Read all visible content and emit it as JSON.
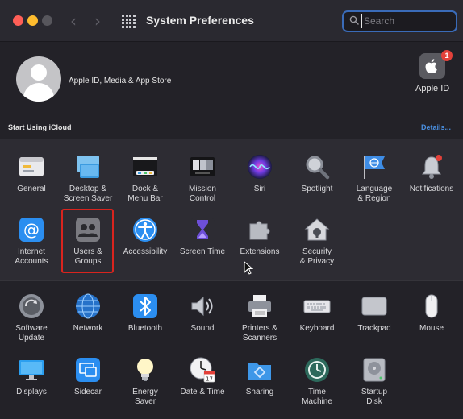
{
  "window": {
    "title": "System Preferences"
  },
  "search": {
    "placeholder": "Search"
  },
  "account": {
    "label": "Apple ID, Media & App Store",
    "apple_id_label": "Apple ID",
    "badge_count": "1",
    "icloud_label": "Start Using iCloud",
    "details_link": "Details..."
  },
  "prefs_row1": [
    {
      "label": "General",
      "icon": "general-icon"
    },
    {
      "label": "Desktop &\nScreen Saver",
      "icon": "desktop-icon"
    },
    {
      "label": "Dock &\nMenu Bar",
      "icon": "dock-icon"
    },
    {
      "label": "Mission\nControl",
      "icon": "mission-control-icon"
    },
    {
      "label": "Siri",
      "icon": "siri-icon"
    },
    {
      "label": "Spotlight",
      "icon": "spotlight-icon"
    },
    {
      "label": "Language\n& Region",
      "icon": "language-region-icon"
    },
    {
      "label": "Notifications",
      "icon": "notifications-icon"
    }
  ],
  "prefs_row2": [
    {
      "label": "Internet\nAccounts",
      "icon": "internet-accounts-icon"
    },
    {
      "label": "Users &\nGroups",
      "icon": "users-groups-icon"
    },
    {
      "label": "Accessibility",
      "icon": "accessibility-icon"
    },
    {
      "label": "Screen Time",
      "icon": "screen-time-icon"
    },
    {
      "label": "Extensions",
      "icon": "extensions-icon"
    },
    {
      "label": "Security\n& Privacy",
      "icon": "security-privacy-icon"
    }
  ],
  "prefs_row3": [
    {
      "label": "Software\nUpdate",
      "icon": "software-update-icon"
    },
    {
      "label": "Network",
      "icon": "network-icon"
    },
    {
      "label": "Bluetooth",
      "icon": "bluetooth-icon"
    },
    {
      "label": "Sound",
      "icon": "sound-icon"
    },
    {
      "label": "Printers &\nScanners",
      "icon": "printers-icon"
    },
    {
      "label": "Keyboard",
      "icon": "keyboard-icon"
    },
    {
      "label": "Trackpad",
      "icon": "trackpad-icon"
    },
    {
      "label": "Mouse",
      "icon": "mouse-icon"
    }
  ],
  "prefs_row4": [
    {
      "label": "Displays",
      "icon": "displays-icon"
    },
    {
      "label": "Sidecar",
      "icon": "sidecar-icon"
    },
    {
      "label": "Energy\nSaver",
      "icon": "energy-saver-icon"
    },
    {
      "label": "Date & Time",
      "icon": "date-time-icon"
    },
    {
      "label": "Sharing",
      "icon": "sharing-icon"
    },
    {
      "label": "Time\nMachine",
      "icon": "time-machine-icon"
    },
    {
      "label": "Startup\nDisk",
      "icon": "startup-disk-icon"
    }
  ],
  "calendar_day": "17",
  "colors": {
    "accent": "#3a6bb8",
    "highlight": "#d9241e",
    "link": "#4a8fe0"
  }
}
